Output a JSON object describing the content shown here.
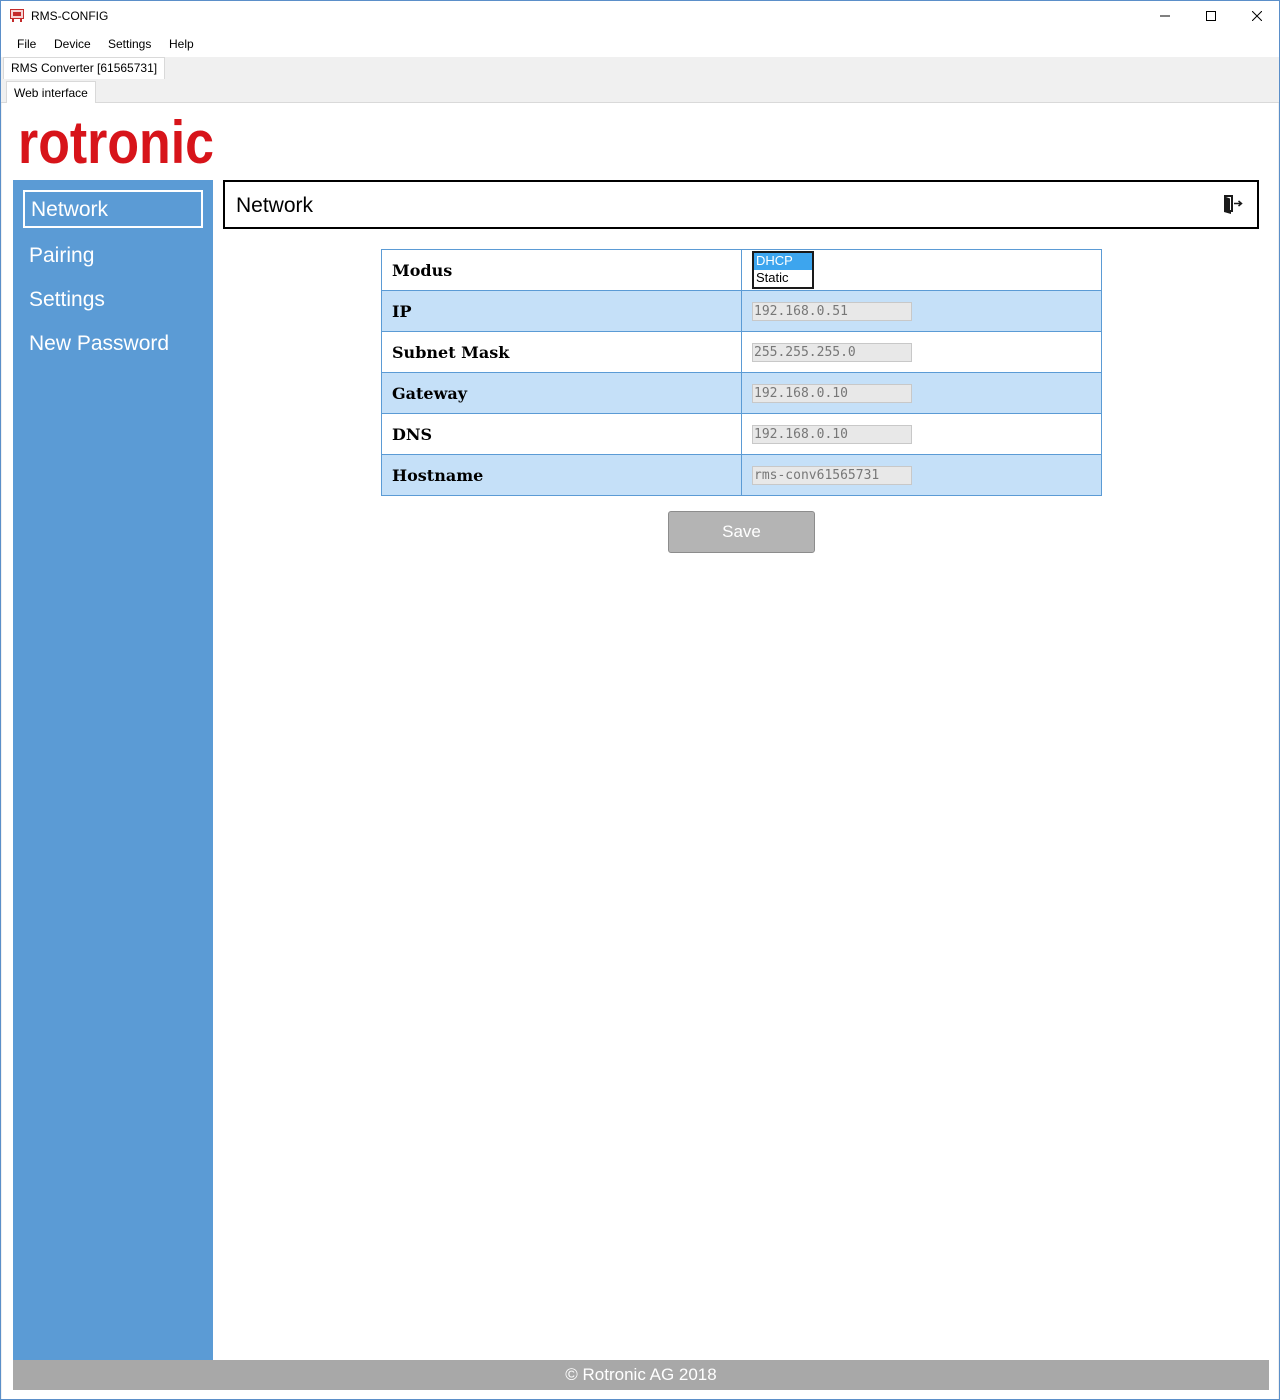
{
  "window": {
    "title": "RMS-CONFIG",
    "minimize": "—",
    "maximize": "☐",
    "close": "✕"
  },
  "menu": [
    "File",
    "Device",
    "Settings",
    "Help"
  ],
  "device_tab": "RMS Converter [61565731]",
  "inner_tab": "Web interface",
  "logo": {
    "text": "rotronic",
    "color": "#d7141a"
  },
  "sidebar": {
    "items": [
      {
        "label": "Network",
        "active": true
      },
      {
        "label": "Pairing"
      },
      {
        "label": "Settings"
      },
      {
        "label": "New Password"
      }
    ]
  },
  "header": {
    "title": "Network",
    "exit_icon": "logout-icon"
  },
  "form": {
    "modus_label": "Modus",
    "modus_options": [
      "DHCP",
      "Static"
    ],
    "modus_selected": "DHCP",
    "rows": [
      {
        "label": "IP",
        "value": "192.168.0.51"
      },
      {
        "label": "Subnet Mask",
        "value": "255.255.255.0"
      },
      {
        "label": "Gateway",
        "value": "192.168.0.10"
      },
      {
        "label": "DNS",
        "value": "192.168.0.10"
      },
      {
        "label": "Hostname",
        "value": "rms-conv61565731"
      }
    ],
    "save_label": "Save"
  },
  "footer": "© Rotronic AG 2018",
  "colors": {
    "sidebar": "#5b9bd5",
    "row_alt": "#c5e0f8",
    "brand_red": "#d7141a",
    "footer": "#a8a8a8"
  }
}
